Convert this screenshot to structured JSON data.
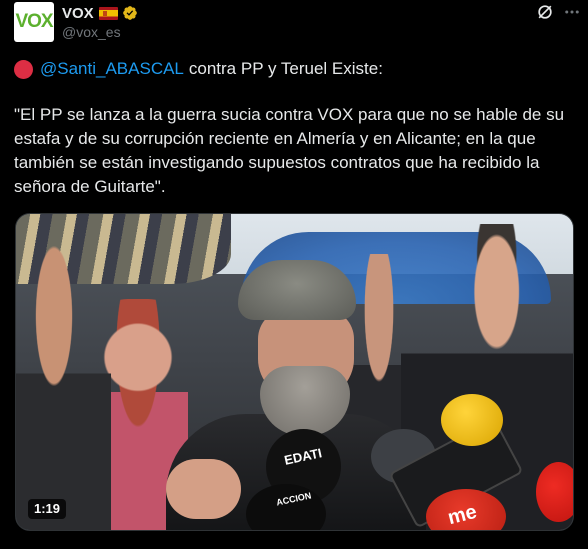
{
  "author": {
    "avatar_text": "VOX",
    "display_name": "VOX",
    "handle": "@vox_es",
    "flag": "spain-flag-icon",
    "verified": "gold-verified-badge-icon"
  },
  "header_icons": {
    "grok": "grok-icon",
    "more": "more-options-icon"
  },
  "tweet": {
    "lead_emoji": "red-circle-icon",
    "mention": "@Santi_ABASCAL",
    "line1_rest": "contra PP y Teruel Existe:",
    "quote": "\"El PP se lanza a la guerra sucia contra VOX para que no se hable de su estafa y de su corrupción reciente en Almería y en Alicante; en la que también se están investigando supuestos contratos que ha recibido la señora de Guitarte\"."
  },
  "media": {
    "type": "video",
    "duration": "1:19",
    "mic_labels": [
      "EDATI",
      "me",
      "ACCION"
    ]
  },
  "colors": {
    "background": "#000000",
    "text": "#e7e9ea",
    "muted": "#71767b",
    "link": "#1d9bf0",
    "brand_green": "#5cb02e",
    "verified_gold": "#e2b719"
  }
}
